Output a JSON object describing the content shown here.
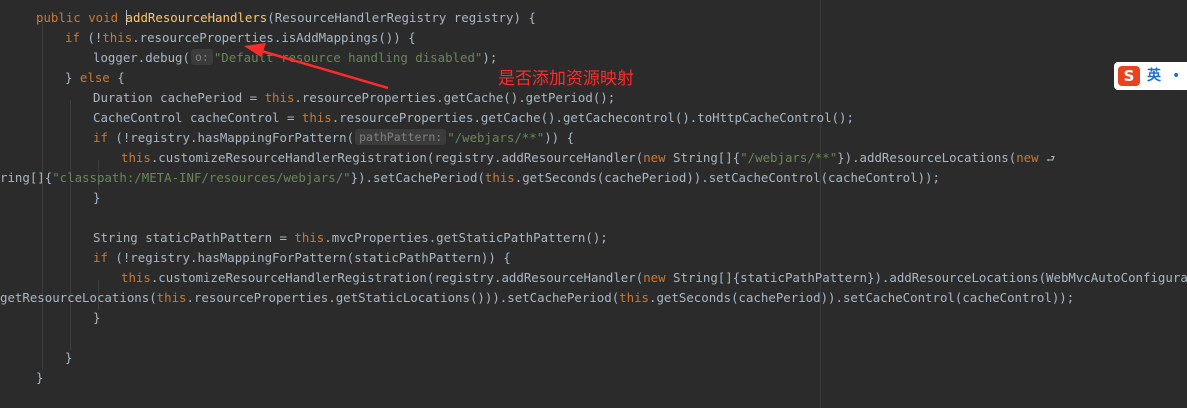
{
  "code": {
    "l1": {
      "kw": "public void ",
      "method": "addResourceHandlers",
      "rest": "(ResourceHandlerRegistry registry) {"
    },
    "l2": {
      "kw1": "if ",
      "p1": "(!",
      "kw2": "this",
      "rest": ".resourceProperties.isAddMappings()) {"
    },
    "l3": {
      "pre": "logger.debug(",
      "hint": "o:",
      "str": "\"Default resource handling disabled\"",
      "post": ");"
    },
    "l4": {
      "pre": "} ",
      "kw": "else",
      "post": " {"
    },
    "l5": {
      "pre": "Duration cachePeriod = ",
      "kw": "this",
      "post": ".resourceProperties.getCache().getPeriod();"
    },
    "l6": {
      "pre": "CacheControl cacheControl = ",
      "kw": "this",
      "post": ".resourceProperties.getCache().getCachecontrol().toHttpCacheControl();"
    },
    "l7": {
      "kw": "if ",
      "pre": "(!registry.hasMappingForPattern(",
      "hint": "pathPattern:",
      "str": "\"/webjars/**\"",
      "post": ")) {"
    },
    "l8": {
      "kw1": "this",
      "p1": ".customizeResourceHandlerRegistration(registry.addResourceHandler(",
      "kw2": "new ",
      "p2": "String[]{",
      "str": "\"/webjars/**\"",
      "p3": "}).addResourceLocations(",
      "kw3": "new"
    },
    "l9": {
      "p1": "ring[]{",
      "str": "\"classpath:/META-INF/resources/webjars/\"",
      "p2": "}).setCachePeriod(",
      "kw1": "this",
      "p3": ".getSeconds(cachePeriod)).setCacheControl(cacheControl));"
    },
    "l10": {
      "text": "}"
    },
    "l12": {
      "pre": "String staticPathPattern = ",
      "kw": "this",
      "post": ".mvcProperties.getStaticPathPattern();"
    },
    "l13": {
      "kw": "if ",
      "post": "(!registry.hasMappingForPattern(staticPathPattern)) {"
    },
    "l14": {
      "kw1": "this",
      "p1": ".customizeResourceHandlerRegistration(registry.addResourceHandler(",
      "kw2": "new ",
      "p2": "String[]{staticPathPattern}).addResourceLocations(WebMvcAutoConfiguration"
    },
    "l15": {
      "p1": "getResourceLocations(",
      "kw1": "this",
      "p2": ".resourceProperties.getStaticLocations())).setCachePeriod(",
      "kw2": "this",
      "p3": ".getSeconds(cachePeriod)).setCacheControl(cacheControl));"
    },
    "l16": {
      "text": "}"
    },
    "l18": {
      "text": "}"
    },
    "l19": {
      "text": "}"
    },
    "wrap_glyph": "⮐"
  },
  "annotation": {
    "text": "是否添加资源映射",
    "color": "#ff2a2a"
  },
  "ime": {
    "logo": "S",
    "mode": "英",
    "extra": "•"
  },
  "colors": {
    "background": "#2b2b2b",
    "keyword": "#cc7832",
    "method": "#ffc66d",
    "string": "#6a8759",
    "text": "#a9b7c6"
  }
}
